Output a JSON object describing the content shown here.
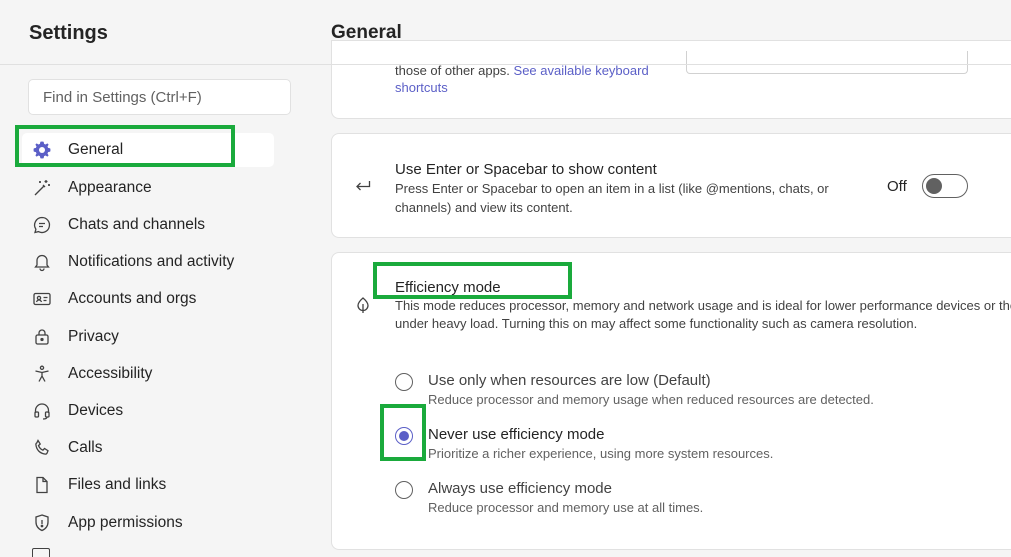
{
  "sidebar": {
    "title": "Settings",
    "search_placeholder": "Find in Settings (Ctrl+F)",
    "items": [
      {
        "label": "General",
        "icon": "gear-icon",
        "selected": true
      },
      {
        "label": "Appearance",
        "icon": "magic-wand-icon"
      },
      {
        "label": "Chats and channels",
        "icon": "chat-icon"
      },
      {
        "label": "Notifications and activity",
        "icon": "bell-icon"
      },
      {
        "label": "Accounts and orgs",
        "icon": "contact-card-icon"
      },
      {
        "label": "Privacy",
        "icon": "lock-icon"
      },
      {
        "label": "Accessibility",
        "icon": "accessibility-icon"
      },
      {
        "label": "Devices",
        "icon": "headset-icon"
      },
      {
        "label": "Calls",
        "icon": "phone-icon"
      },
      {
        "label": "Files and links",
        "icon": "document-icon"
      },
      {
        "label": "App permissions",
        "icon": "shield-icon"
      }
    ]
  },
  "main": {
    "title": "General",
    "keyboard_card": {
      "text_before": "those of other apps. ",
      "link_text": "See available keyboard shortcuts"
    },
    "enter_card": {
      "title": "Use Enter or Spacebar to show content",
      "description": "Press Enter or Spacebar to open an item in a list (like @mentions, chats, or channels) and view its content.",
      "toggle_label": "Off",
      "toggle_on": false
    },
    "efficiency_card": {
      "title": "Efficiency mode",
      "description": "This mode reduces processor, memory and network usage and is ideal for lower performance devices or those under heavy load. Turning this on may affect some functionality such as camera resolution.",
      "options": [
        {
          "label": "Use only when resources are low (Default)",
          "description": "Reduce processor and memory usage when reduced resources are detected.",
          "checked": false
        },
        {
          "label": "Never use efficiency mode",
          "description": "Prioritize a richer experience, using more system resources.",
          "checked": true
        },
        {
          "label": "Always use efficiency mode",
          "description": "Reduce processor and memory use at all times.",
          "checked": false
        }
      ]
    }
  },
  "colors": {
    "accent": "#5b5fc7",
    "highlight": "#1aaa3c"
  }
}
